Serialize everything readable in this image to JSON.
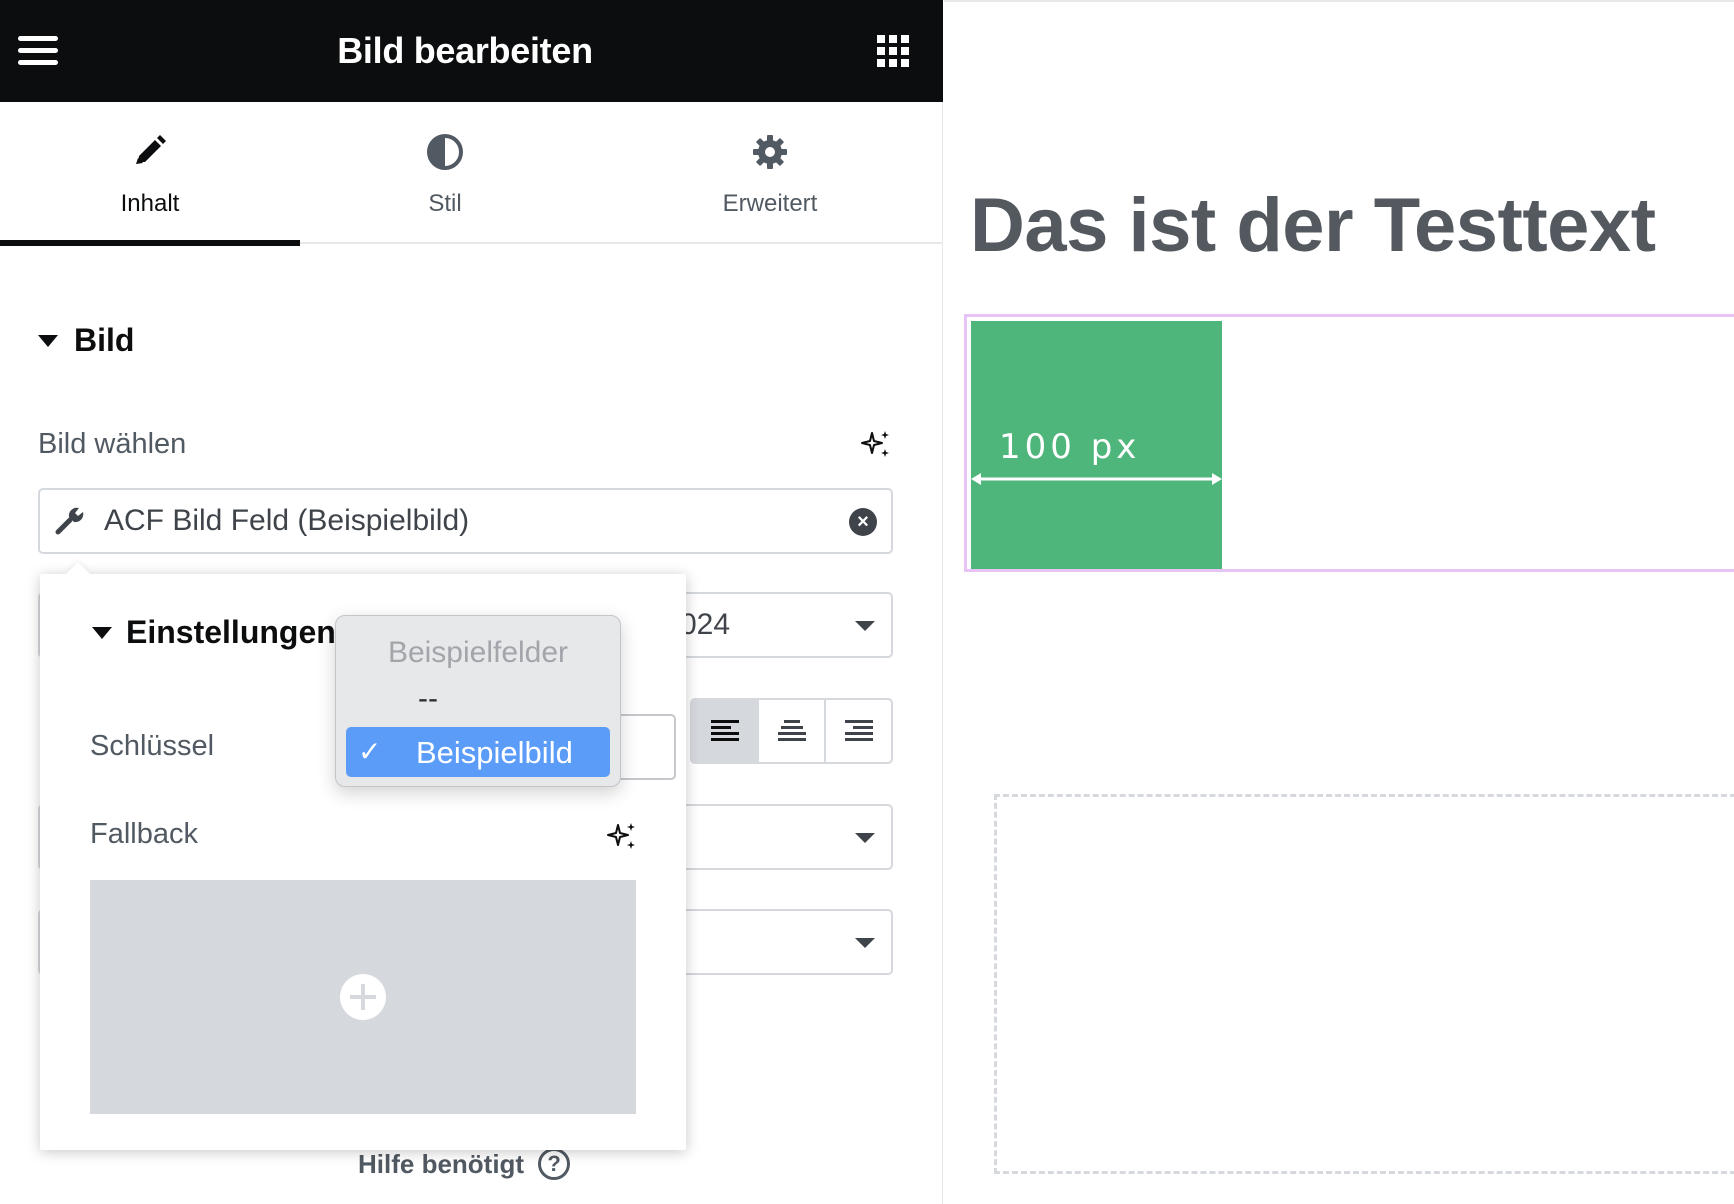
{
  "topbar": {
    "title": "Bild bearbeiten",
    "menu_icon": "hamburger-icon",
    "apps_icon": "apps-grid-icon"
  },
  "tabs": [
    {
      "label": "Inhalt",
      "icon": "pencil-icon",
      "active": true
    },
    {
      "label": "Stil",
      "icon": "contrast-icon",
      "active": false
    },
    {
      "label": "Erweitert",
      "icon": "gear-icon",
      "active": false
    }
  ],
  "section": {
    "title": "Bild"
  },
  "image_field": {
    "label": "Bild wählen",
    "value": "ACF Bild Feld (Beispielbild)",
    "ai_icon": "sparkle-icon"
  },
  "size_select": {
    "partial_value": "024"
  },
  "popover": {
    "title": "Einstellungen",
    "key_label": "Schlüssel",
    "fallback_label": "Fallback"
  },
  "dropdown": {
    "group_label": "Beispielfelder",
    "separator": "--",
    "selected_check": "✓",
    "selected_option": "Beispielbild"
  },
  "help": {
    "label": "Hilfe benötigt",
    "icon_text": "?"
  },
  "preview": {
    "heading": "Das ist der Testtext",
    "image_label": "100 px"
  },
  "colors": {
    "topbar": "#0c0d0e",
    "accent_selected": "#5a9cf8",
    "image_green": "#4fb67b",
    "widget_outline": "#e8c3f6"
  }
}
